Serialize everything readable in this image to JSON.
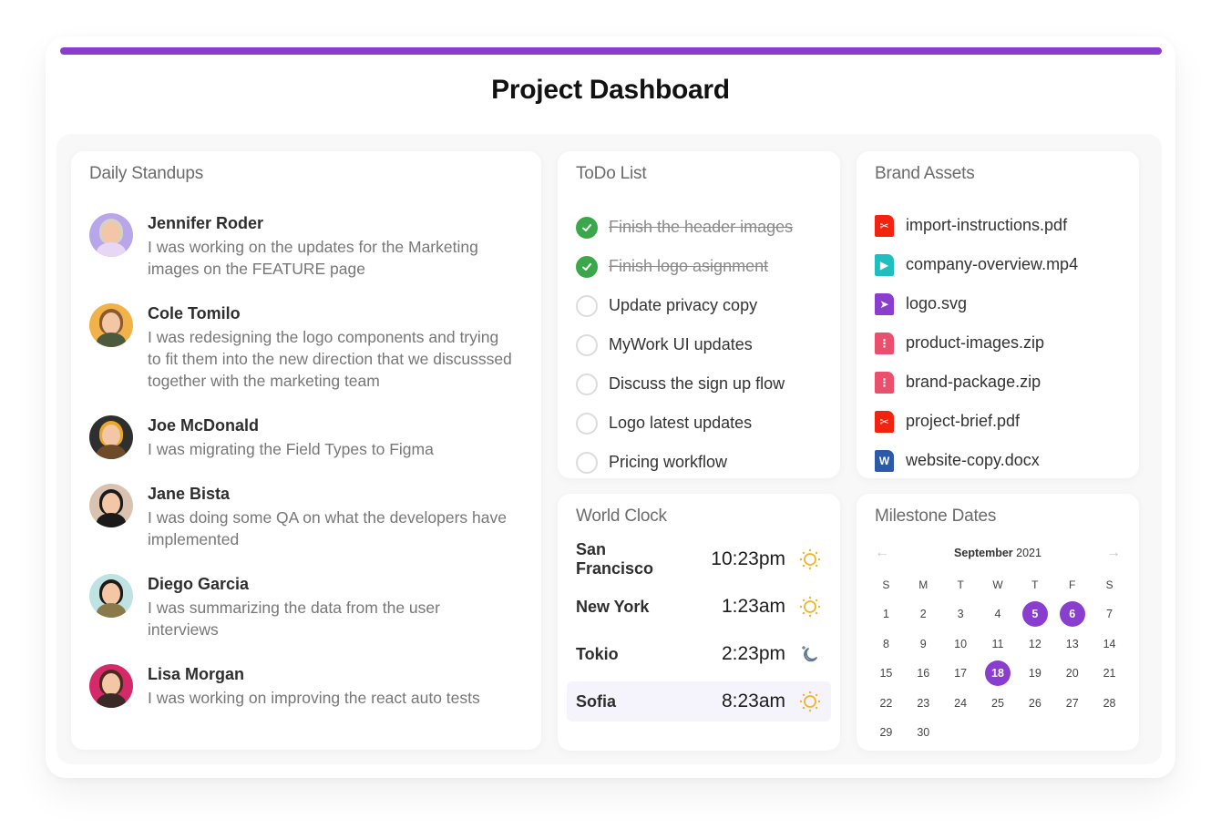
{
  "page": {
    "title": "Project Dashboard",
    "accent_color": "#8a3ecf"
  },
  "standups": {
    "title": "Daily Standups",
    "items": [
      {
        "name": "Jennifer Roder",
        "note": "I was working on the updates for the Marketing images on the FEATURE page",
        "avatar_bg": "#b7a6e8",
        "shirt": "#e8d6f5",
        "hair": "#d9d0c4"
      },
      {
        "name": "Cole Tomilo",
        "note": "I was redesigning the logo components and trying to fit them into the new direction that we discusssed together with the marketing team",
        "avatar_bg": "#f2b24a",
        "shirt": "#4b5a3c",
        "hair": "#8a5a2e"
      },
      {
        "name": "Joe McDonald",
        "note": "I was migrating the Field Types to Figma",
        "avatar_bg": "#2f2f2f",
        "shirt": "#6e4a2a",
        "hair": "#e8a92a"
      },
      {
        "name": "Jane Bista",
        "note": "I was doing some QA on what the developers have implemented",
        "avatar_bg": "#d9c3b0",
        "shirt": "#1a1a1a",
        "hair": "#1a1a1a"
      },
      {
        "name": "Diego Garcia",
        "note": "I was summarizing the data from the user interviews",
        "avatar_bg": "#bfe3e3",
        "shirt": "#8a7a4a",
        "hair": "#1e1a16"
      },
      {
        "name": "Lisa Morgan",
        "note": "I was working on improving the react auto tests",
        "avatar_bg": "#d42a6a",
        "shirt": "#3a2a26",
        "hair": "#4a2a1e"
      }
    ]
  },
  "todo": {
    "title": "ToDo List",
    "items": [
      {
        "label": "Finish the header images",
        "done": true
      },
      {
        "label": "Finish logo asignment",
        "done": true
      },
      {
        "label": "Update privacy copy",
        "done": false
      },
      {
        "label": "MyWork UI updates",
        "done": false
      },
      {
        "label": "Discuss the sign up flow",
        "done": false
      },
      {
        "label": "Logo latest updates",
        "done": false
      },
      {
        "label": "Pricing workflow",
        "done": false
      }
    ]
  },
  "assets": {
    "title": "Brand Assets",
    "items": [
      {
        "name": "import-instructions.pdf",
        "type": "pdf-icon",
        "color": "#f2230f",
        "glyph": "✂"
      },
      {
        "name": "company-overview.mp4",
        "type": "video-icon",
        "color": "#1fbfc0",
        "glyph": "▶"
      },
      {
        "name": "logo.svg",
        "type": "vector-icon",
        "color": "#8a3ecf",
        "glyph": "➤"
      },
      {
        "name": "product-images.zip",
        "type": "zip-icon",
        "color": "#ea4f6e",
        "glyph": "⋮"
      },
      {
        "name": "brand-package.zip",
        "type": "zip-icon",
        "color": "#ea4f6e",
        "glyph": "⋮"
      },
      {
        "name": "project-brief.pdf",
        "type": "pdf-icon",
        "color": "#f2230f",
        "glyph": "✂"
      },
      {
        "name": "website-copy.docx",
        "type": "word-icon",
        "color": "#2b5aa8",
        "glyph": "W"
      }
    ]
  },
  "world_clock": {
    "title": "World Clock",
    "rows": [
      {
        "city": "San Francisco",
        "time": "10:23pm",
        "icon": "sun-icon",
        "highlight": false
      },
      {
        "city": "New York",
        "time": "1:23am",
        "icon": "sun-icon",
        "highlight": false
      },
      {
        "city": "Tokio",
        "time": "2:23pm",
        "icon": "moon-icon",
        "highlight": false
      },
      {
        "city": "Sofia",
        "time": "8:23am",
        "icon": "sun-icon",
        "highlight": true
      }
    ],
    "sun_color": "#f5b32a",
    "moon_color": "#5e7890"
  },
  "milestones": {
    "title": "Milestone Dates",
    "month": "September",
    "year": "2021",
    "prev_label": "←",
    "next_label": "→",
    "weekdays": [
      "S",
      "M",
      "T",
      "W",
      "T",
      "F",
      "S"
    ],
    "first_weekday_offset": 0,
    "days_in_month": 30,
    "marked_days": [
      5,
      6,
      18
    ]
  }
}
